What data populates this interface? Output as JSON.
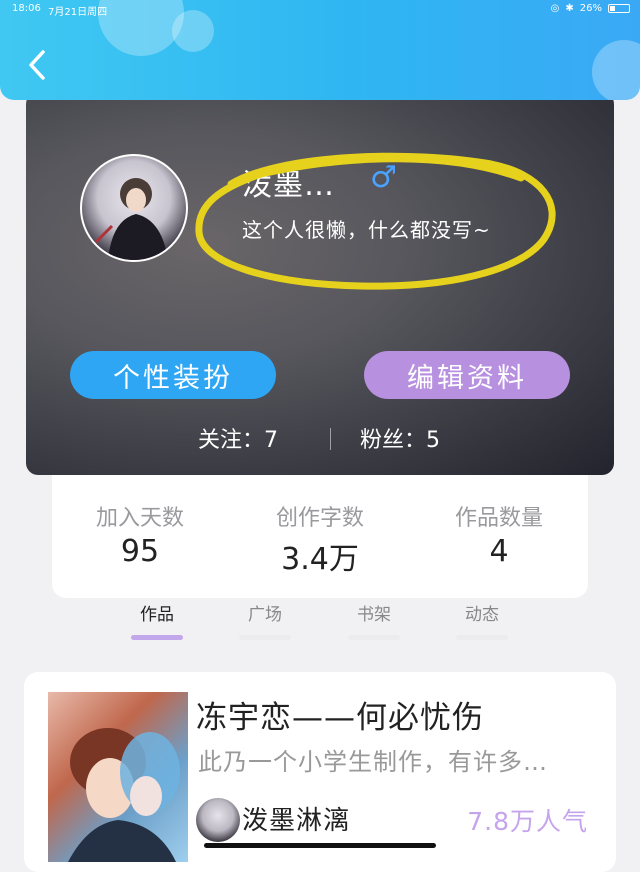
{
  "status_bar": {
    "time": "18:06",
    "date": "7月21日周四",
    "battery": "26%"
  },
  "profile": {
    "nickname": "泼墨…",
    "gender_symbol": "♂",
    "bio": "这个人很懒，什么都没写~",
    "dress_button": "个性装扮",
    "edit_button": "编辑资料",
    "following": "关注：7",
    "fans": "粉丝：5"
  },
  "stats": [
    {
      "label": "加入天数",
      "value": "95"
    },
    {
      "label": "创作字数",
      "value": "3.4万"
    },
    {
      "label": "作品数量",
      "value": "4"
    }
  ],
  "tabs": [
    {
      "label": "作品",
      "active": true
    },
    {
      "label": "广场",
      "active": false
    },
    {
      "label": "书架",
      "active": false
    },
    {
      "label": "动态",
      "active": false
    }
  ],
  "work": {
    "title": "冻宇恋——何必忧伤",
    "description": "此乃一个小学生制作，有许多…",
    "author": "泼墨淋漓",
    "popularity": "7.8万人气"
  },
  "colors": {
    "header_blue": "#2fb6f2",
    "dress_button": "#2fa6f4",
    "edit_button": "#b890e0",
    "gender": "#4aa3ff",
    "popularity": "#c5a4ec",
    "highlight_circle": "#e6d21c"
  }
}
